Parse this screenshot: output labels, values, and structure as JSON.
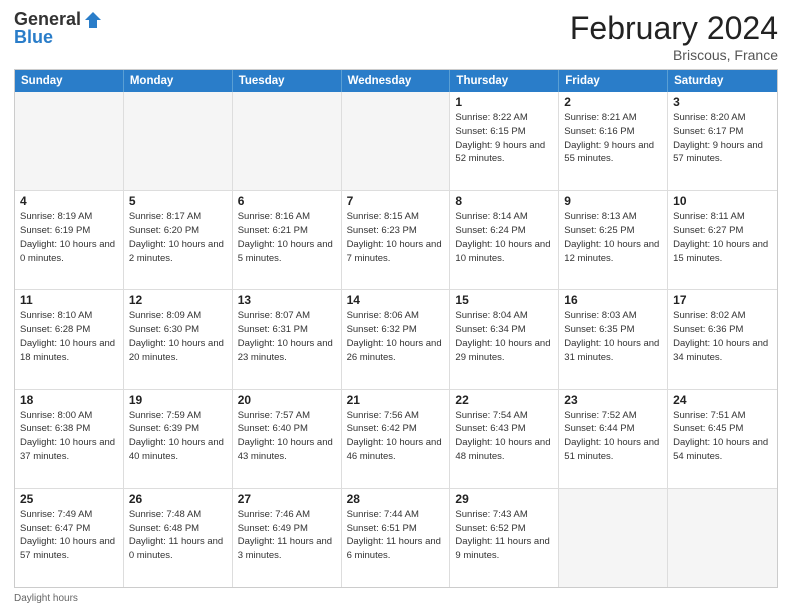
{
  "logo": {
    "general": "General",
    "blue": "Blue"
  },
  "title": {
    "month_year": "February 2024",
    "location": "Briscous, France"
  },
  "calendar": {
    "headers": [
      "Sunday",
      "Monday",
      "Tuesday",
      "Wednesday",
      "Thursday",
      "Friday",
      "Saturday"
    ],
    "rows": [
      [
        {
          "day": "",
          "info": ""
        },
        {
          "day": "",
          "info": ""
        },
        {
          "day": "",
          "info": ""
        },
        {
          "day": "",
          "info": ""
        },
        {
          "day": "1",
          "info": "Sunrise: 8:22 AM\nSunset: 6:15 PM\nDaylight: 9 hours and 52 minutes."
        },
        {
          "day": "2",
          "info": "Sunrise: 8:21 AM\nSunset: 6:16 PM\nDaylight: 9 hours and 55 minutes."
        },
        {
          "day": "3",
          "info": "Sunrise: 8:20 AM\nSunset: 6:17 PM\nDaylight: 9 hours and 57 minutes."
        }
      ],
      [
        {
          "day": "4",
          "info": "Sunrise: 8:19 AM\nSunset: 6:19 PM\nDaylight: 10 hours and 0 minutes."
        },
        {
          "day": "5",
          "info": "Sunrise: 8:17 AM\nSunset: 6:20 PM\nDaylight: 10 hours and 2 minutes."
        },
        {
          "day": "6",
          "info": "Sunrise: 8:16 AM\nSunset: 6:21 PM\nDaylight: 10 hours and 5 minutes."
        },
        {
          "day": "7",
          "info": "Sunrise: 8:15 AM\nSunset: 6:23 PM\nDaylight: 10 hours and 7 minutes."
        },
        {
          "day": "8",
          "info": "Sunrise: 8:14 AM\nSunset: 6:24 PM\nDaylight: 10 hours and 10 minutes."
        },
        {
          "day": "9",
          "info": "Sunrise: 8:13 AM\nSunset: 6:25 PM\nDaylight: 10 hours and 12 minutes."
        },
        {
          "day": "10",
          "info": "Sunrise: 8:11 AM\nSunset: 6:27 PM\nDaylight: 10 hours and 15 minutes."
        }
      ],
      [
        {
          "day": "11",
          "info": "Sunrise: 8:10 AM\nSunset: 6:28 PM\nDaylight: 10 hours and 18 minutes."
        },
        {
          "day": "12",
          "info": "Sunrise: 8:09 AM\nSunset: 6:30 PM\nDaylight: 10 hours and 20 minutes."
        },
        {
          "day": "13",
          "info": "Sunrise: 8:07 AM\nSunset: 6:31 PM\nDaylight: 10 hours and 23 minutes."
        },
        {
          "day": "14",
          "info": "Sunrise: 8:06 AM\nSunset: 6:32 PM\nDaylight: 10 hours and 26 minutes."
        },
        {
          "day": "15",
          "info": "Sunrise: 8:04 AM\nSunset: 6:34 PM\nDaylight: 10 hours and 29 minutes."
        },
        {
          "day": "16",
          "info": "Sunrise: 8:03 AM\nSunset: 6:35 PM\nDaylight: 10 hours and 31 minutes."
        },
        {
          "day": "17",
          "info": "Sunrise: 8:02 AM\nSunset: 6:36 PM\nDaylight: 10 hours and 34 minutes."
        }
      ],
      [
        {
          "day": "18",
          "info": "Sunrise: 8:00 AM\nSunset: 6:38 PM\nDaylight: 10 hours and 37 minutes."
        },
        {
          "day": "19",
          "info": "Sunrise: 7:59 AM\nSunset: 6:39 PM\nDaylight: 10 hours and 40 minutes."
        },
        {
          "day": "20",
          "info": "Sunrise: 7:57 AM\nSunset: 6:40 PM\nDaylight: 10 hours and 43 minutes."
        },
        {
          "day": "21",
          "info": "Sunrise: 7:56 AM\nSunset: 6:42 PM\nDaylight: 10 hours and 46 minutes."
        },
        {
          "day": "22",
          "info": "Sunrise: 7:54 AM\nSunset: 6:43 PM\nDaylight: 10 hours and 48 minutes."
        },
        {
          "day": "23",
          "info": "Sunrise: 7:52 AM\nSunset: 6:44 PM\nDaylight: 10 hours and 51 minutes."
        },
        {
          "day": "24",
          "info": "Sunrise: 7:51 AM\nSunset: 6:45 PM\nDaylight: 10 hours and 54 minutes."
        }
      ],
      [
        {
          "day": "25",
          "info": "Sunrise: 7:49 AM\nSunset: 6:47 PM\nDaylight: 10 hours and 57 minutes."
        },
        {
          "day": "26",
          "info": "Sunrise: 7:48 AM\nSunset: 6:48 PM\nDaylight: 11 hours and 0 minutes."
        },
        {
          "day": "27",
          "info": "Sunrise: 7:46 AM\nSunset: 6:49 PM\nDaylight: 11 hours and 3 minutes."
        },
        {
          "day": "28",
          "info": "Sunrise: 7:44 AM\nSunset: 6:51 PM\nDaylight: 11 hours and 6 minutes."
        },
        {
          "day": "29",
          "info": "Sunrise: 7:43 AM\nSunset: 6:52 PM\nDaylight: 11 hours and 9 minutes."
        },
        {
          "day": "",
          "info": ""
        },
        {
          "day": "",
          "info": ""
        }
      ]
    ]
  },
  "footer": {
    "daylight_label": "Daylight hours"
  }
}
